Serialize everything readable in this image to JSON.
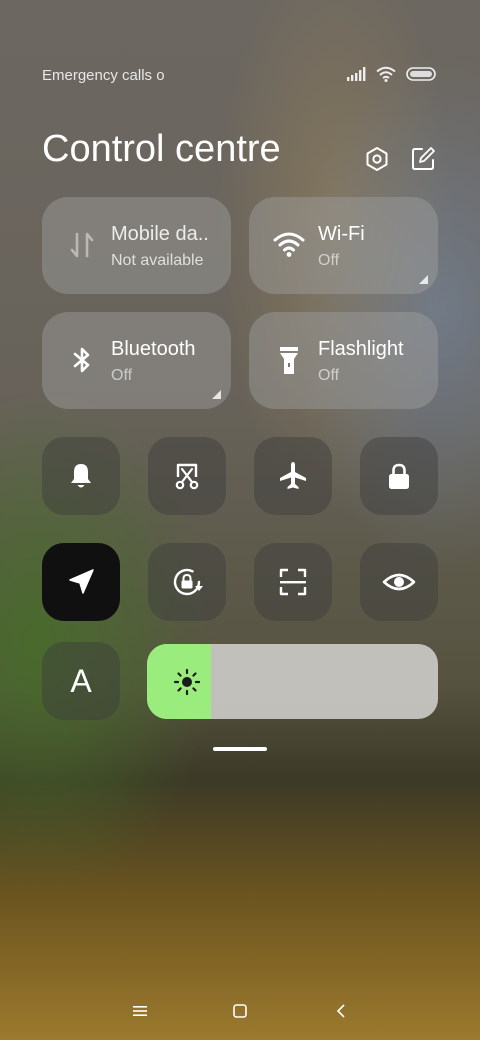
{
  "status": {
    "text": "Emergency calls o",
    "icons": [
      "signal-icon",
      "wifi-icon",
      "battery-icon"
    ]
  },
  "header": {
    "title": "Control centre",
    "icons": [
      "settings-icon",
      "edit-icon"
    ]
  },
  "tiles": [
    {
      "label": "Mobile da..",
      "sub": "Not available",
      "icon": "mobile-data-icon"
    },
    {
      "label": "Wi-Fi",
      "sub": "Off",
      "icon": "wifi-icon"
    },
    {
      "label": "Bluetooth",
      "sub": "Off",
      "icon": "bluetooth-icon"
    },
    {
      "label": "Flashlight",
      "sub": "Off",
      "icon": "flashlight-icon"
    }
  ],
  "toggles": [
    "bell-icon",
    "screenshot-icon",
    "airplane-icon",
    "lock-icon",
    "location-icon",
    "rotation-lock-icon",
    "scanner-icon",
    "eye-icon"
  ],
  "font_button": {
    "label": "A"
  },
  "brightness": {
    "level": 0.22,
    "icon": "sun-icon"
  },
  "navigation": [
    "menu-icon",
    "home-icon",
    "back-icon"
  ],
  "colors": {
    "brightness_fill": "#9aec7c",
    "active_toggle": "#101010"
  }
}
